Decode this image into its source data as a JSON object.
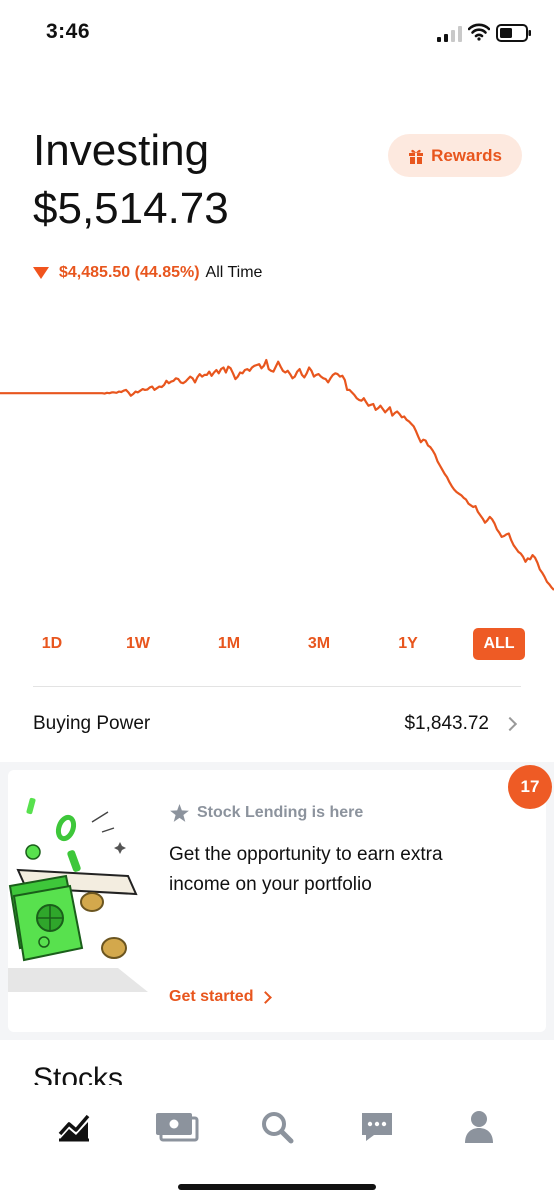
{
  "status_bar": {
    "time": "3:46"
  },
  "header": {
    "title": "Investing",
    "balance": "$5,514.73",
    "change_value": "$4,485.50 (44.85%)",
    "change_period": "All Time",
    "rewards_label": "Rewards"
  },
  "colors": {
    "accent": "#ee5b25",
    "accent_text": "#e8561e",
    "accent_light": "#fde9df",
    "muted": "#8c939d"
  },
  "chart_data": {
    "type": "line",
    "values": [
      100,
      100,
      100,
      100,
      100,
      100,
      100,
      100,
      100,
      100,
      100,
      100,
      100,
      100,
      100,
      100,
      100,
      100,
      100,
      100,
      100,
      100,
      100,
      100,
      100,
      100,
      100,
      100,
      100,
      100,
      100,
      100,
      100,
      100,
      100,
      100,
      100,
      100,
      100,
      100,
      100,
      100,
      100,
      100,
      99.5,
      100.5,
      100,
      101,
      101,
      100.5,
      102,
      101.5,
      103,
      104,
      101,
      97,
      99,
      102,
      101,
      103,
      105,
      104,
      104.5,
      107,
      108,
      104,
      106,
      108,
      107.5,
      110,
      115,
      112,
      114,
      115,
      118,
      117,
      113,
      112,
      114,
      117,
      120,
      118,
      113,
      119,
      123,
      120,
      122,
      122,
      126,
      121,
      125,
      128,
      124,
      129,
      131,
      125,
      132,
      130,
      124,
      117,
      120,
      125,
      124,
      128,
      129,
      127,
      131,
      133,
      134,
      135,
      130,
      133,
      140,
      129,
      127,
      126,
      132,
      138,
      132,
      127,
      125,
      127,
      123,
      118,
      120,
      126,
      129,
      122,
      119,
      124,
      131,
      127,
      120,
      122,
      123,
      120,
      118,
      117,
      113,
      118,
      122,
      124,
      123,
      120,
      121,
      116,
      104,
      104,
      101,
      98,
      94,
      92,
      91,
      94,
      89,
      85,
      86,
      87,
      80,
      82,
      85,
      81,
      77,
      80,
      83,
      73,
      76,
      78,
      75,
      71,
      72,
      68,
      66,
      63,
      60,
      54,
      47,
      41,
      44,
      43,
      37,
      35,
      31,
      26,
      18,
      13,
      8,
      3,
      -1,
      -7,
      -12,
      -16,
      -19,
      -21,
      -23,
      -26,
      -28,
      -33,
      -35,
      -37,
      -36,
      -43,
      -47,
      -51,
      -56,
      -53,
      -49,
      -52,
      -57,
      -64,
      -68,
      -73,
      -72,
      -70,
      -69,
      -77,
      -83,
      -87,
      -91,
      -93,
      -97,
      -103,
      -99,
      -100,
      -95,
      -98,
      -104,
      -112,
      -116,
      -121,
      -127,
      -130,
      -134,
      -137
    ]
  },
  "ranges": [
    {
      "label": "1D",
      "active": false
    },
    {
      "label": "1W",
      "active": false
    },
    {
      "label": "1M",
      "active": false
    },
    {
      "label": "3M",
      "active": false
    },
    {
      "label": "1Y",
      "active": false
    },
    {
      "label": "ALL",
      "active": true
    }
  ],
  "buying_power": {
    "label": "Buying Power",
    "value": "$1,843.72"
  },
  "promo": {
    "kicker": "Stock Lending is here",
    "body": "Get the opportunity to earn extra income on your portfolio",
    "cta": "Get started",
    "badge_count": "17"
  },
  "section": {
    "stocks_heading": "Stocks"
  },
  "tabs": [
    {
      "icon": "chart-line-icon"
    },
    {
      "icon": "cash-card-icon"
    },
    {
      "icon": "search-icon"
    },
    {
      "icon": "chat-bubble-icon"
    },
    {
      "icon": "account-person-icon"
    }
  ]
}
